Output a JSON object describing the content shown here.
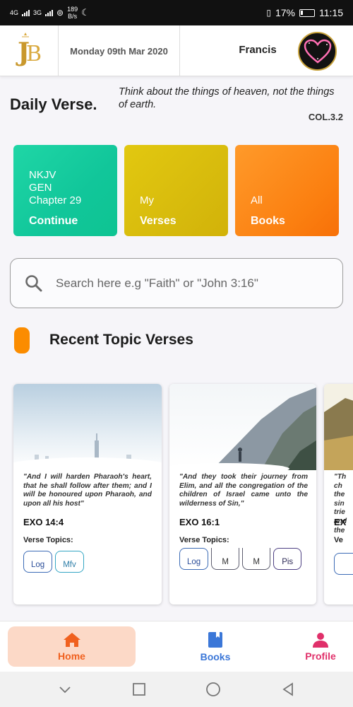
{
  "status_bar": {
    "left": "4G 3G",
    "speed_value": "189",
    "speed_unit": "B/s",
    "battery": "17%",
    "time": "11:15"
  },
  "header": {
    "logo_icon": "jb-logo-icon",
    "date": "Monday 09th Mar 2020",
    "user_name": "Francis",
    "avatar_icon": "heart-sparkle-avatar"
  },
  "daily": {
    "title": "Daily Verse.",
    "text": "Think about the things of heaven, not the things of earth.",
    "reference": "COL.3.2"
  },
  "tiles": [
    {
      "lines": [
        "NKJV",
        "GEN",
        "Chapter 29"
      ],
      "action": "Continue",
      "color": "#14cc9c"
    },
    {
      "lines": [
        "My"
      ],
      "action": "Verses",
      "color": "#dabd0e"
    },
    {
      "lines": [
        "All"
      ],
      "action": "Books",
      "color": "#f97c0e"
    }
  ],
  "search": {
    "placeholder": "Search here e.g \"Faith\" or \"John 3:16\""
  },
  "section": {
    "title": "Recent Topic Verses",
    "accent": "#fb8c00"
  },
  "cards": [
    {
      "quote": "\"And I will harden Pharaoh's heart, that he shall follow after them; and I will be honoured upon Pharaoh, and upon all his host\"",
      "ref": "EXO 14:4",
      "topics_label": "Verse Topics:",
      "topics": [
        "Log",
        "Mfv"
      ]
    },
    {
      "quote": "\"And they took their journey from Elim, and all the congregation of the children of Israel came unto the wilderness of Sin,\"",
      "ref": "EXO 16:1",
      "topics_label": "Verse Topics:",
      "topics": [
        "Log",
        "M",
        "M",
        "Pis"
      ]
    },
    {
      "quote_lines": [
        "\"Th",
        "ch",
        "the",
        "sin",
        "trie",
        "and",
        "the"
      ],
      "ref": "EX",
      "topics_label": "Ve"
    }
  ],
  "bottom_nav": {
    "home": "Home",
    "books": "Books",
    "profile": "Profile",
    "home_color": "#f0601e",
    "books_color": "#3b77d8",
    "profile_color": "#e0306a"
  }
}
